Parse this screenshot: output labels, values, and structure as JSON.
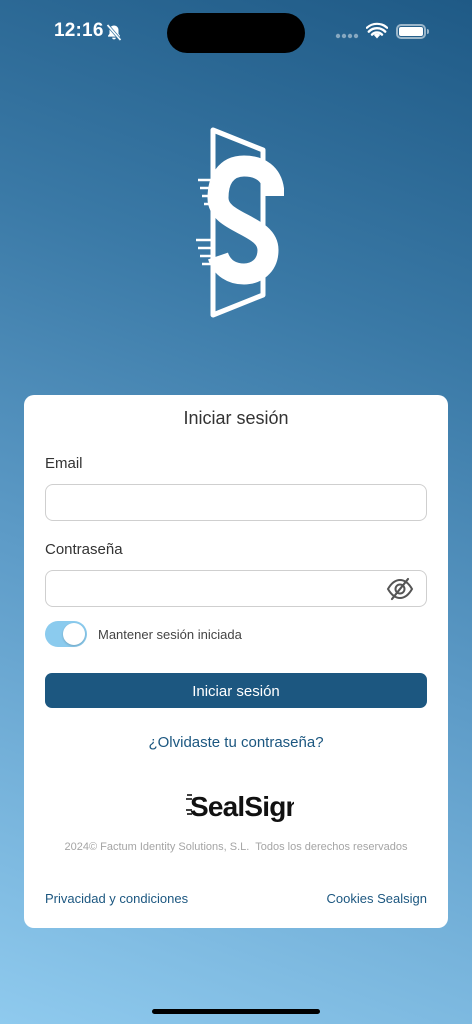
{
  "status_bar": {
    "time": "12:16",
    "icons": [
      "bell-slash-icon",
      "cellular-signal-icon",
      "wifi-icon",
      "battery-icon"
    ]
  },
  "logo": {
    "icon": "sealsign-s-logo-icon"
  },
  "login_card": {
    "title": "Iniciar sesión",
    "email": {
      "label": "Email",
      "value": "",
      "placeholder": ""
    },
    "password": {
      "label": "Contraseña",
      "value": "",
      "placeholder": "",
      "toggle_icon": "eye-slash-icon"
    },
    "remember": {
      "label": "Mantener sesión iniciada",
      "checked": true
    },
    "submit_label": "Iniciar sesión",
    "forgot_link": "¿Olvidaste tu contraseña?",
    "brand": {
      "text": "SealSign"
    },
    "copyright": "2024© Factum Identity Solutions, S.L.  Todos los derechos reservados",
    "privacy_link": "Privacidad y condiciones",
    "cookies_link": "Cookies Sealsign"
  },
  "colors": {
    "primary": "#1c5780",
    "toggle_on": "#8bcbee",
    "background_top": "#1f5a86",
    "background_bottom": "#8fcaee"
  }
}
